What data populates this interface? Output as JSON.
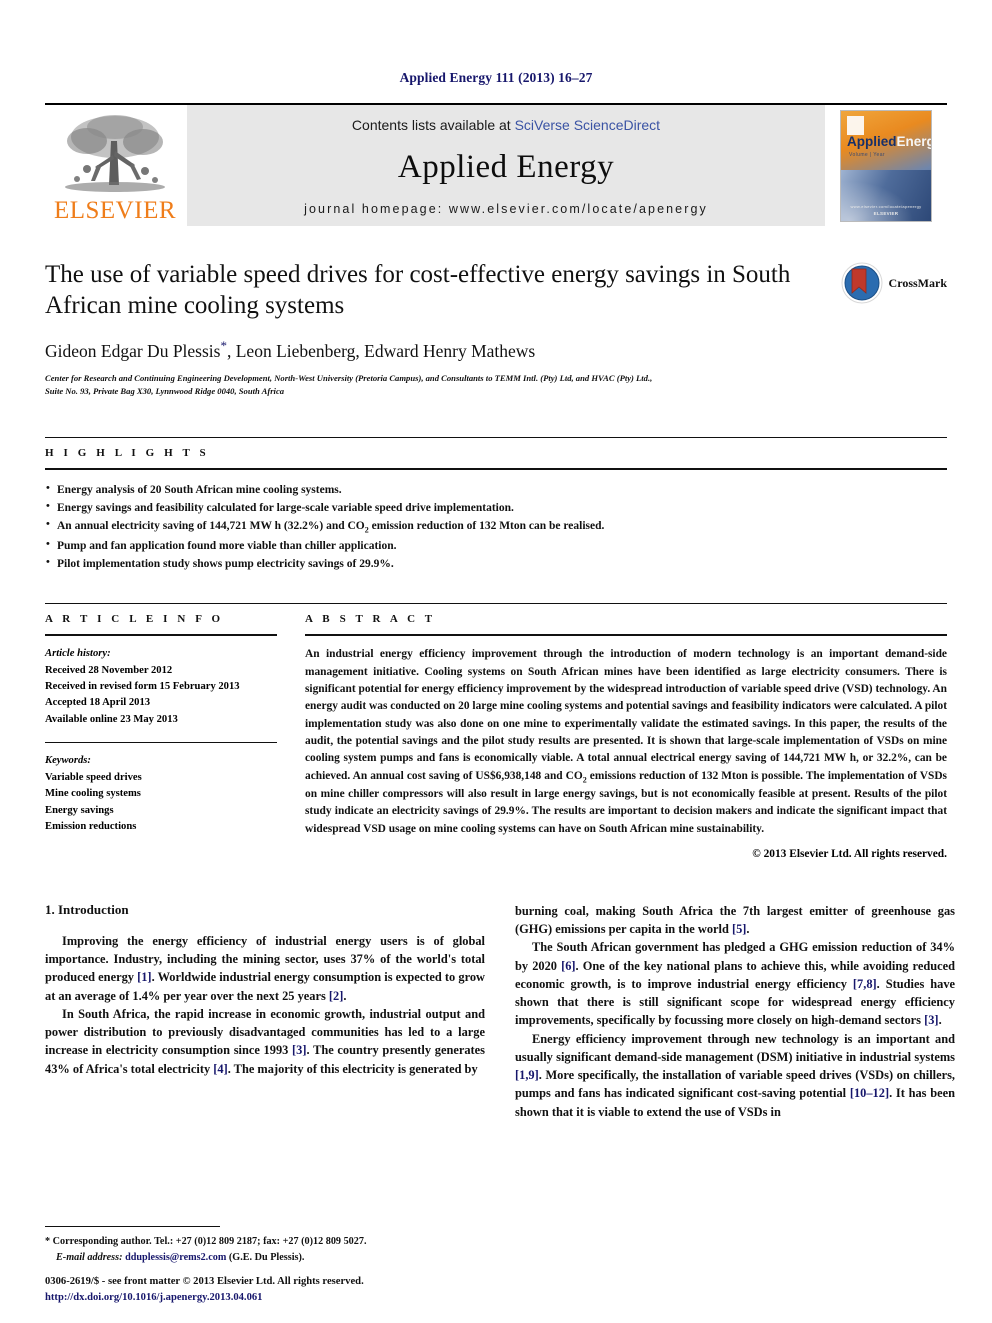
{
  "running_head": "Applied Energy 111 (2013) 16–27",
  "masthead": {
    "publisher_name": "ELSEVIER",
    "contents_prefix": "Contents lists available at ",
    "contents_link": "SciVerse ScienceDirect",
    "journal_title": "Applied Energy",
    "homepage": "journal homepage: www.elsevier.com/locate/apenergy",
    "cover": {
      "title_part1": "Applied",
      "title_part2": "Energy",
      "subtitle": "Volume  |  Year",
      "footer_small": "www.elsevier.com/locate/apenergy",
      "footer_brand": "ELSEVIER"
    }
  },
  "article": {
    "title": "The use of variable speed drives for cost-effective energy savings in South African mine cooling systems",
    "authors": "Gideon Edgar Du Plessis",
    "authors_rest": ", Leon Liebenberg, Edward Henry Mathews",
    "corresponding_marker": "*",
    "affiliation_line1": "Center for Research and Continuing Engineering Development, North-West University (Pretoria Campus), and Consultants to TEMM Intl. (Pty) Ltd, and HVAC (Pty) Ltd.,",
    "affiliation_line2": "Suite No. 93, Private Bag X30, Lynnwood Ridge 0040, South Africa",
    "crossmark_label": "CrossMark"
  },
  "highlights": {
    "label": "H I G H L I G H T S",
    "items": [
      "Energy analysis of 20 South African mine cooling systems.",
      "Energy savings and feasibility calculated for large-scale variable speed drive implementation.",
      "An annual electricity saving of 144,721 MW h (32.2%) and CO2 emission reduction of 132 Mton can be realised.",
      "Pump and fan application found more viable than chiller application.",
      "Pilot implementation study shows pump electricity savings of 29.9%."
    ]
  },
  "article_info": {
    "label": "A R T I C L E  I N F O",
    "history_label": "Article history:",
    "history": [
      "Received 28 November 2012",
      "Received in revised form 15 February 2013",
      "Accepted 18 April 2013",
      "Available online 23 May 2013"
    ],
    "keywords_label": "Keywords:",
    "keywords": [
      "Variable speed drives",
      "Mine cooling systems",
      "Energy savings",
      "Emission reductions"
    ]
  },
  "abstract": {
    "label": "A B S T R A C T",
    "text_part1": "An industrial energy efficiency improvement through the introduction of modern technology is an important demand-side management initiative. Cooling systems on South African mines have been identified as large electricity consumers. There is significant potential for energy efficiency improvement by the widespread introduction of variable speed drive (VSD) technology. An energy audit was conducted on 20 large mine cooling systems and potential savings and feasibility indicators were calculated. A pilot implementation study was also done on one mine to experimentally validate the estimated savings. In this paper, the results of the audit, the potential savings and the pilot study results are presented. It is shown that large-scale implementation of VSDs on mine cooling system pumps and fans is economically viable. A total annual electrical energy saving of 144,721 MW h, or 32.2%, can be achieved. An annual cost saving of US$6,938,148 and CO",
    "text_sub": "2",
    "text_part2": " emissions reduction of 132 Mton is possible. The implementation of VSDs on mine chiller compressors will also result in large energy savings, but is not economically feasible at present. Results of the pilot study indicate an electricity savings of 29.9%. The results are important to decision makers and indicate the significant impact that widespread VSD usage on mine cooling systems can have on South African mine sustainability.",
    "copyright": "© 2013 Elsevier Ltd. All rights reserved."
  },
  "introduction": {
    "heading": "1. Introduction",
    "left_paragraphs": [
      {
        "segments": [
          {
            "t": "Improving the energy efficiency of industrial energy users is of global importance. Industry, including the mining sector, uses 37% of the world's total produced energy "
          },
          {
            "t": "[1]",
            "cite": true
          },
          {
            "t": ". Worldwide industrial energy consumption is expected to grow at an average of 1.4% per year over the next 25 years "
          },
          {
            "t": "[2]",
            "cite": true
          },
          {
            "t": "."
          }
        ]
      },
      {
        "segments": [
          {
            "t": "In South Africa, the rapid increase in economic growth, industrial output and power distribution to previously disadvantaged communities has led to a large increase in electricity consumption since 1993 "
          },
          {
            "t": "[3]",
            "cite": true
          },
          {
            "t": ". The country presently generates 43% of Africa's total electricity "
          },
          {
            "t": "[4]",
            "cite": true
          },
          {
            "t": ". The majority of this electricity is generated by"
          }
        ]
      }
    ],
    "right_paragraphs": [
      {
        "segments": [
          {
            "t": "burning coal, making South Africa the 7th largest emitter of greenhouse gas (GHG) emissions per capita in the world "
          },
          {
            "t": "[5]",
            "cite": true
          },
          {
            "t": "."
          }
        ],
        "no_indent": true
      },
      {
        "segments": [
          {
            "t": "The South African government has pledged a GHG emission reduction of 34% by 2020 "
          },
          {
            "t": "[6]",
            "cite": true
          },
          {
            "t": ". One of the key national plans to achieve this, while avoiding reduced economic growth, is to improve industrial energy efficiency "
          },
          {
            "t": "[7,8]",
            "cite": true
          },
          {
            "t": ". Studies have shown that there is still significant scope for widespread energy efficiency improvements, specifically by focussing more closely on high-demand sectors "
          },
          {
            "t": "[3]",
            "cite": true
          },
          {
            "t": "."
          }
        ]
      },
      {
        "segments": [
          {
            "t": "Energy efficiency improvement through new technology is an important and usually significant demand-side management (DSM) initiative in industrial systems "
          },
          {
            "t": "[1,9]",
            "cite": true
          },
          {
            "t": ". More specifically, the installation of variable speed drives (VSDs) on chillers, pumps and fans has indicated significant cost-saving potential "
          },
          {
            "t": "[10–12]",
            "cite": true
          },
          {
            "t": ". It has been shown that it is viable to extend the use of VSDs in"
          }
        ]
      }
    ]
  },
  "footnotes": {
    "corresponding": "* Corresponding author. Tel.: +27 (0)12 809 2187; fax: +27 (0)12 809 5027.",
    "email_label": "E-mail address:",
    "email": "dduplessis@rems2.com",
    "email_owner": "(G.E. Du Plessis).",
    "issn_line": "0306-2619/$ - see front matter © 2013 Elsevier Ltd. All rights reserved.",
    "doi": "http://dx.doi.org/10.1016/j.apenergy.2013.04.061"
  },
  "colors": {
    "link_blue": "#16166b",
    "sciencedirect_blue": "#3a53a4",
    "elsevier_orange": "#ef7d1a"
  }
}
